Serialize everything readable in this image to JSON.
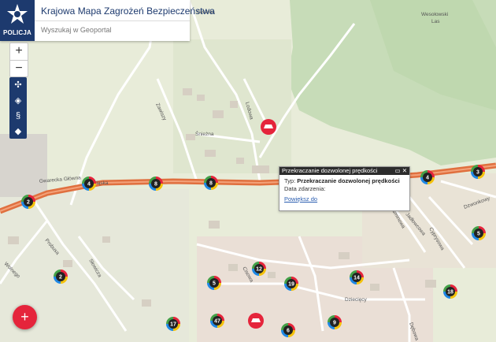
{
  "header": {
    "logo_text": "POLICJA",
    "title": "Krajowa Mapa Zagrożeń Bezpieczeństwa",
    "search_placeholder": "Wyszukaj w Geoportal"
  },
  "controls": {
    "zoom_in": "+",
    "zoom_out": "−",
    "tools": [
      {
        "icon": "fullscreen-icon",
        "glyph": "✣"
      },
      {
        "icon": "locate-icon",
        "glyph": "◈"
      },
      {
        "icon": "law-icon",
        "glyph": "§"
      },
      {
        "icon": "tag-icon",
        "glyph": "◆"
      }
    ],
    "add_button": "+"
  },
  "popup": {
    "title": "Przekraczanie dozwolonej prędkości",
    "type_label": "Typ:",
    "type_value": "Przekraczanie dozwolonej prędkości",
    "date_label": "Data zdarzenia:",
    "link": "Powiększ do"
  },
  "streets": {
    "gwarna": "Gwarna",
    "main_street": "Gwarecka Główna",
    "slaska": "Śląska",
    "zawiszy": "Zawiszy",
    "lodowa": "Lodowa",
    "sniezna": "Śnieżna",
    "probusa": "Probusa",
    "slowicza": "Słowicza",
    "wolnego": "Wolnego",
    "cisowa": "Cisowa",
    "dziecieca": "Dziecięcy",
    "jadlowcowa": "Jadłowcowa",
    "cyprysowa": "Cyprysowa",
    "jasminowa": "Jaśminowa",
    "dzwonkowy": "Dzwonkowy",
    "debowa": "Dębowa",
    "wesolowski": "Wesołowski",
    "las": "Las"
  },
  "markers": [
    {
      "label": "2"
    },
    {
      "label": "4"
    },
    {
      "label": "8"
    },
    {
      "label": "8"
    },
    {
      "label": "4"
    },
    {
      "label": "3"
    },
    {
      "label": "5"
    },
    {
      "label": "2"
    },
    {
      "label": "5"
    },
    {
      "label": "12"
    },
    {
      "label": "19"
    },
    {
      "label": "14"
    },
    {
      "label": "18"
    },
    {
      "label": "17"
    },
    {
      "label": "47"
    },
    {
      "label": "6"
    },
    {
      "label": "9"
    }
  ],
  "colors": {
    "police_blue": "#1d3a6e",
    "road_orange": "#e0703f",
    "accident_red": "#e5243b",
    "forest": "#c7dcb8"
  }
}
